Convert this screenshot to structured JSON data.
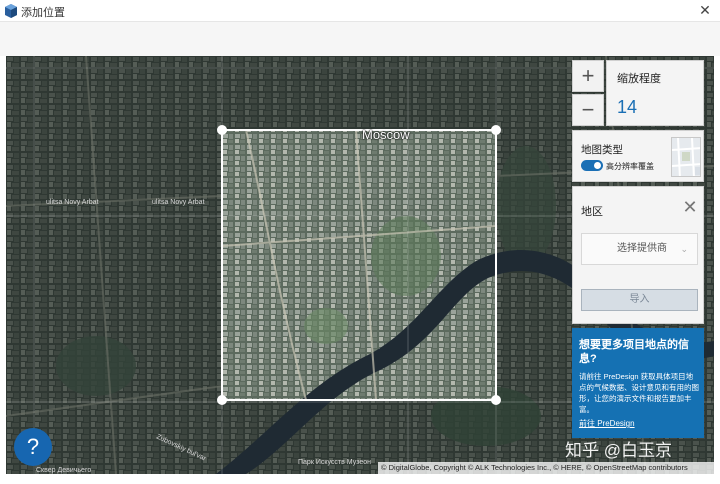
{
  "window": {
    "title": "添加位置",
    "close_glyph": "✕",
    "icon": "app-cube-icon"
  },
  "map": {
    "city_label": "Moscow",
    "street_labels": [
      "ulitsa Novy Arbat",
      "ulitsa Novy Arbat",
      "Zubovskiy bul'var",
      "Сквер Девичьего",
      "Парк Искусств Музеон"
    ],
    "attribution": "© DigitalGlobe, Copyright © ALK Technologies Inc., © HERE, © OpenStreetMap contributors"
  },
  "zoom": {
    "plus_glyph": "+",
    "minus_glyph": "−",
    "label": "缩放程度",
    "value": "14"
  },
  "map_type": {
    "label": "地图类型",
    "toggle_label": "高分辨率覆盖",
    "toggle_on": true
  },
  "region": {
    "label": "地区",
    "close_glyph": "✕",
    "provider_placeholder": "选择提供商",
    "import_label": "导入"
  },
  "info": {
    "title": "想要更多项目地点的信息?",
    "body": "请前往 PreDesign 获取具体项目地点的气候数据、设计意见和有用的图形，让您的演示文件和报告更加丰富。",
    "link": "前往 PreDesign"
  },
  "help": {
    "glyph": "?"
  },
  "watermark": "知乎 @白玉京",
  "colors": {
    "accent": "#1571b3",
    "zoom_value": "#1a6fb5",
    "map_dark": "#2c3530",
    "river": "#1f2a33"
  }
}
